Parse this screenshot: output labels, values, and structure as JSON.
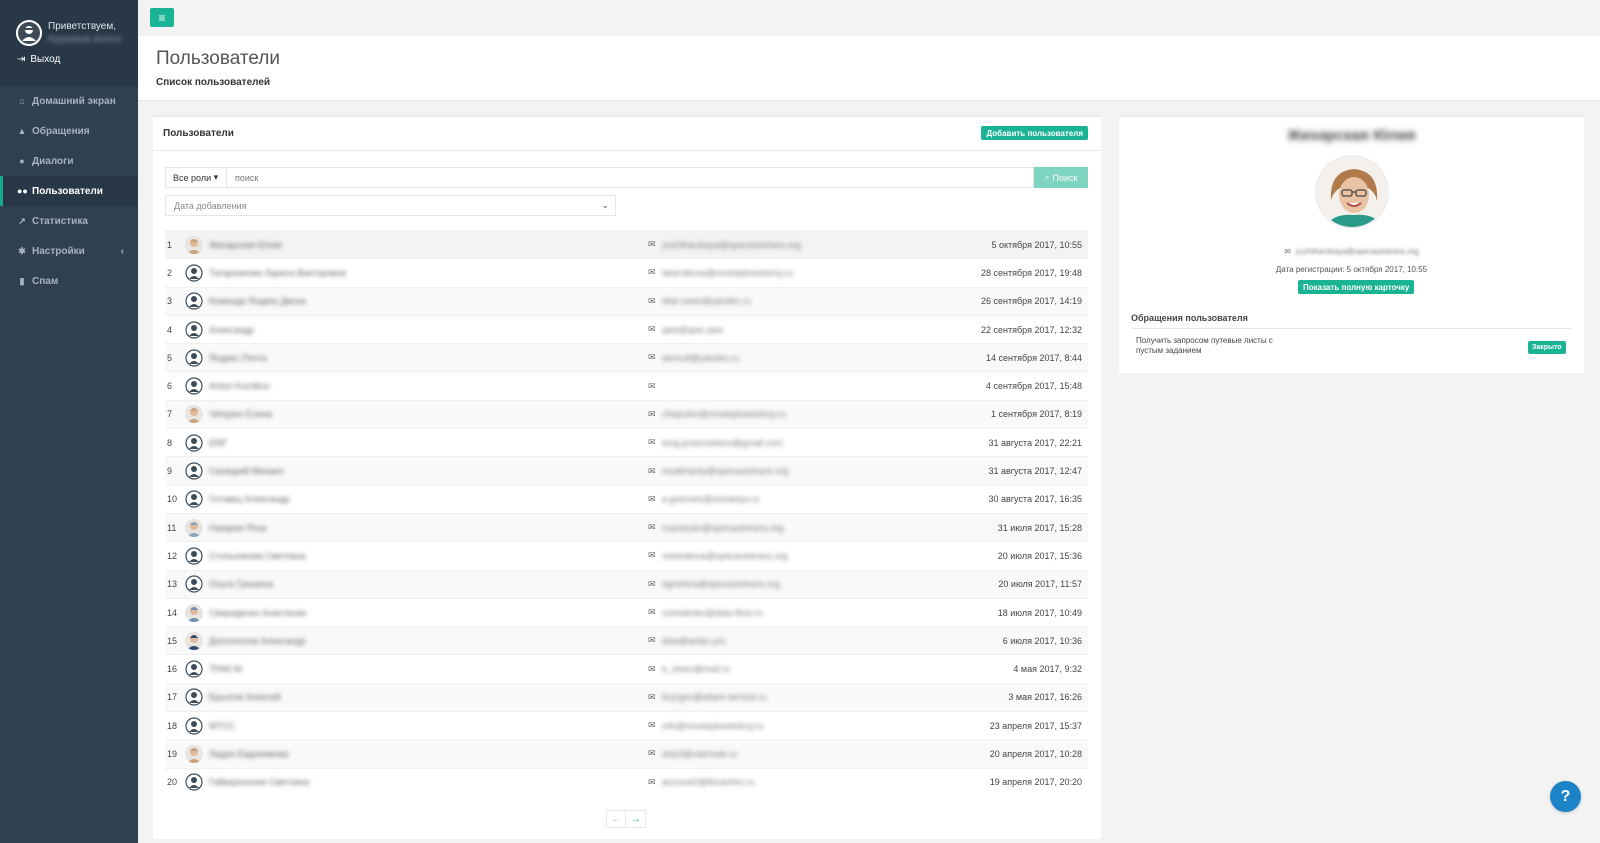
{
  "sidebar": {
    "greeting": "Приветствуем,",
    "username": "Курников Антон",
    "logout": "Выход",
    "items": [
      {
        "label": "Домашний экран",
        "icon": "home-icon"
      },
      {
        "label": "Обращения",
        "icon": "warning-icon"
      },
      {
        "label": "Диалоги",
        "icon": "user-icon"
      },
      {
        "label": "Пользователи",
        "icon": "users-icon"
      },
      {
        "label": "Статистика",
        "icon": "chart-icon"
      },
      {
        "label": "Настройки",
        "icon": "gear-icon"
      },
      {
        "label": "Спам",
        "icon": "trash-icon"
      }
    ],
    "active_item": "Пользователи"
  },
  "header": {
    "title": "Пользователи",
    "subtitle": "Список пользователей"
  },
  "main": {
    "panel_title": "Пользователи",
    "add_user_button": "Добавить пользователя",
    "roles_dropdown": "Все роли",
    "search_placeholder": "поиск",
    "search_button": "Поиск",
    "date_filter": "Дата добавления",
    "users": [
      {
        "num": "1",
        "name": "Жихарская Юлия",
        "email": "yuzhiharskaya@specautotrans.org",
        "date": "5 октября 2017, 10:55",
        "avatar": "photo"
      },
      {
        "num": "2",
        "name": "Татарникова Лариса Викторовна",
        "email": "tatarnikova@mosteplosetstroy.ru",
        "date": "28 сентября 2017, 19:48",
        "avatar": "default"
      },
      {
        "num": "3",
        "name": "Команда Яндекс.Диска",
        "email": "disk-news@yandex.ru",
        "date": "26 сентября 2017, 14:19",
        "avatar": "default"
      },
      {
        "num": "4",
        "name": "Александр",
        "email": "qwe@qwe.qwe",
        "date": "22 сентября 2017, 12:32",
        "avatar": "default"
      },
      {
        "num": "5",
        "name": "Яндекс.Почта",
        "email": "devnull@yandex.ru",
        "date": "14 сентября 2017, 8:44",
        "avatar": "default"
      },
      {
        "num": "6",
        "name": "Anton Kurnikov",
        "email": "",
        "date": "4 сентября 2017, 15:48",
        "avatar": "default"
      },
      {
        "num": "7",
        "name": "Чепурко Елена",
        "email": "chepurko@mosteplosetstroy.ru",
        "date": "1 сентября 2017, 8:19",
        "avatar": "photo"
      },
      {
        "num": "8",
        "name": "EMГ",
        "email": "emg.proizvodstvo@gmail.com",
        "date": "31 августа 2017, 22:21",
        "avatar": "default"
      },
      {
        "num": "9",
        "name": "Сахацкий Михаил",
        "email": "msakhacky@specautotrans.org",
        "date": "31 августа 2017, 12:47",
        "avatar": "default"
      },
      {
        "num": "10",
        "name": "Готовец Александр",
        "email": "a.gotovets@socialsys.ru",
        "date": "30 августа 2017, 16:35",
        "avatar": "default"
      },
      {
        "num": "11",
        "name": "Назарян Роза",
        "email": "rnazaryan@specautotrans.org",
        "date": "31 июля 2017, 15:28",
        "avatar": "photo"
      },
      {
        "num": "12",
        "name": "Стольникова Светлана",
        "email": "sstolnikova@specautotrans.org",
        "date": "20 июля 2017, 15:36",
        "avatar": "default"
      },
      {
        "num": "13",
        "name": "Ольга Гришина",
        "email": "ogrishina@specautotrans.org",
        "date": "20 июля 2017, 11:57",
        "avatar": "default"
      },
      {
        "num": "14",
        "name": "Свириденко Анастасия",
        "email": "sviredenko@data-floor.ru",
        "date": "18 июля 2017, 10:49",
        "avatar": "photo"
      },
      {
        "num": "15",
        "name": "Долгополов Александр",
        "email": "dola@arilan.pro",
        "date": "6 июля 2017, 10:36",
        "avatar": "photo"
      },
      {
        "num": "16",
        "name": "ТРАК-М",
        "email": "e_shem@mail.ru",
        "date": "4 мая 2017, 9:32",
        "avatar": "default"
      },
      {
        "num": "17",
        "name": "Брызгов Алексей",
        "email": "bryzgov@atlant-service.ru",
        "date": "3 мая 2017, 16:26",
        "avatar": "default"
      },
      {
        "num": "18",
        "name": "МТСС",
        "email": "info@mosteplosetstroy.ru",
        "date": "23 апреля 2017, 15:37",
        "avatar": "default"
      },
      {
        "num": "19",
        "name": "Лидия Евдокимова",
        "email": "disp3@satmoek.ru",
        "date": "20 апреля 2017, 10:28",
        "avatar": "photo"
      },
      {
        "num": "20",
        "name": "Гайворонская Светлана",
        "email": "account2@florachim.ru",
        "date": "19 апреля 2017, 20:20",
        "avatar": "default"
      }
    ],
    "pager_prev": "←",
    "pager_next": "→"
  },
  "detail": {
    "name": "Жихарская Юлия",
    "email": "yuzhiharskaya@specautotrans.org",
    "registration": "Дата регистрации: 5 октября 2017, 10:55",
    "full_card_button": "Показать полную карточку",
    "requests_title": "Обращения пользователя",
    "ticket_text": "Получить запросом путевые листы с пустым заданием",
    "ticket_status": "Закрыто"
  },
  "help_label": "?",
  "colors": {
    "accent": "#1ab394",
    "sidebar": "#2f4050",
    "help": "#1c84c6"
  }
}
